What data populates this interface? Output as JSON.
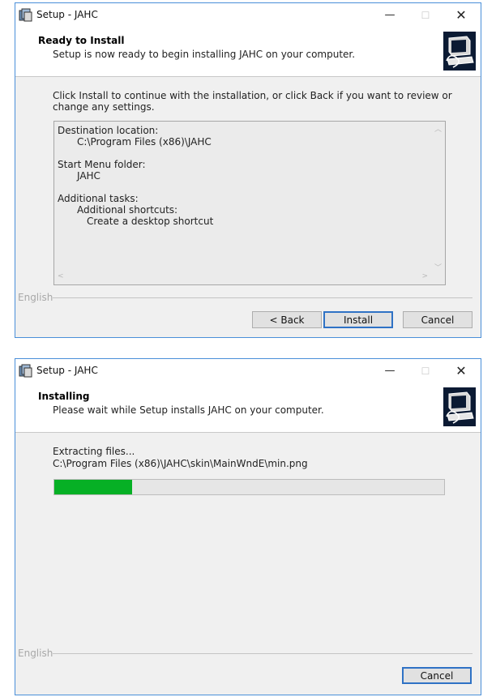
{
  "ready_window": {
    "title": "Setup - JAHC",
    "controls": {
      "minimize": "—",
      "maximize": "☐",
      "close": "✕"
    },
    "header": {
      "title": "Ready to Install",
      "subtitle": "Setup is now ready to begin installing JAHC on your computer."
    },
    "instructions": [
      "Click Install to continue with the installation, or click Back if you want to review or",
      "change any settings."
    ],
    "summary": {
      "destination_label": "Destination location:",
      "destination_value": "C:\\Program Files (x86)\\JAHC",
      "start_menu_label": "Start Menu folder:",
      "start_menu_value": "JAHC",
      "tasks_label": "Additional tasks:",
      "shortcuts_label": "Additional shortcuts:",
      "shortcut_item": "Create a desktop shortcut"
    },
    "language": "English",
    "buttons": {
      "back": "< Back",
      "install": "Install",
      "cancel": "Cancel"
    }
  },
  "installing_window": {
    "title": "Setup - JAHC",
    "controls": {
      "minimize": "—",
      "maximize": "☐",
      "close": "✕"
    },
    "header": {
      "title": "Installing",
      "subtitle": "Please wait while Setup installs JAHC on your computer."
    },
    "status": "Extracting files...",
    "current_file": "C:\\Program Files (x86)\\JAHC\\skin\\MainWndE\\min.png",
    "progress_percent": 20,
    "progress_color": "#06b025",
    "language": "English",
    "buttons": {
      "cancel": "Cancel"
    }
  }
}
